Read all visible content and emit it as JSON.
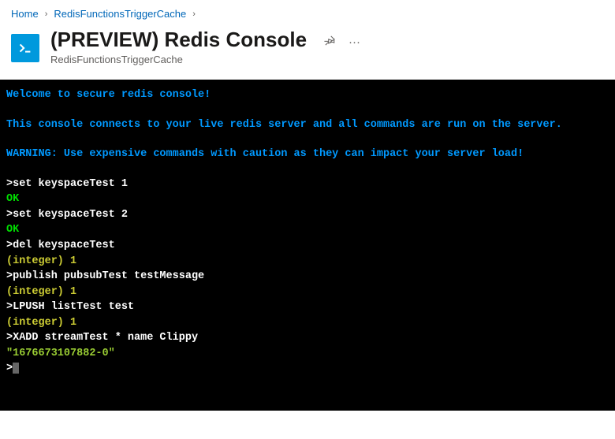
{
  "breadcrumb": {
    "items": [
      {
        "label": "Home"
      },
      {
        "label": "RedisFunctionsTriggerCache"
      }
    ]
  },
  "header": {
    "title": "(PREVIEW) Redis Console",
    "subtitle": "RedisFunctionsTriggerCache"
  },
  "console": {
    "banner": {
      "line1": "Welcome to secure redis console!",
      "line2": "This console connects to your live redis server and all commands are run on the server.",
      "line3": "WARNING: Use expensive commands with caution as they can impact your server load!"
    },
    "lines": [
      {
        "type": "cmd",
        "text": ">set keyspaceTest 1"
      },
      {
        "type": "ok",
        "text": "OK"
      },
      {
        "type": "cmd",
        "text": ">set keyspaceTest 2"
      },
      {
        "type": "ok",
        "text": "OK"
      },
      {
        "type": "cmd",
        "text": ">del keyspaceTest"
      },
      {
        "type": "int",
        "text": "(integer) 1"
      },
      {
        "type": "cmd",
        "text": ">publish pubsubTest testMessage"
      },
      {
        "type": "int",
        "text": "(integer) 1"
      },
      {
        "type": "cmd",
        "text": ">LPUSH listTest test"
      },
      {
        "type": "int",
        "text": "(integer) 1"
      },
      {
        "type": "cmd",
        "text": ">XADD streamTest * name Clippy"
      },
      {
        "type": "str",
        "text": "\"1676673107882-0\""
      }
    ],
    "prompt": ">"
  }
}
